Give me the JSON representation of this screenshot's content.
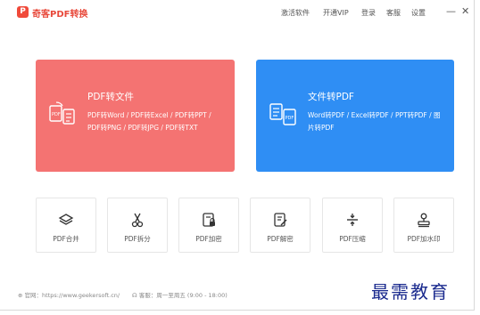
{
  "app": {
    "logo_glyph": "P",
    "title": "奇客PDF转换"
  },
  "topnav": [
    "激活软件",
    "开通VIP",
    "登录",
    "客服",
    "设置"
  ],
  "window_controls": {
    "minimize": "—",
    "close": "✕"
  },
  "cards": [
    {
      "title": "PDF转文件",
      "desc": "PDF转Word / PDF转Excel / PDF转PPT / PDF转PNG / PDF转JPG / PDF转TXT",
      "color": "#f47372",
      "icon": "pdf-to-file-icon"
    },
    {
      "title": "文件转PDF",
      "desc": "Word转PDF / Excel转PDF / PPT转PDF / 图片转PDF",
      "color": "#2f8ef4",
      "icon": "file-to-pdf-icon"
    }
  ],
  "tools": [
    {
      "label": "PDF合并",
      "icon": "layers-icon"
    },
    {
      "label": "PDF拆分",
      "icon": "scissors-icon"
    },
    {
      "label": "PDF加密",
      "icon": "lock-doc-icon"
    },
    {
      "label": "PDF解密",
      "icon": "edit-doc-icon"
    },
    {
      "label": "PDF压缩",
      "icon": "compress-icon"
    },
    {
      "label": "PDF加水印",
      "icon": "stamp-icon"
    }
  ],
  "footer": {
    "website": "官网：https://www.geekersoft.cn/",
    "support": "客服：周一至周五 (9:00 - 18:00)"
  },
  "watermark": "最需教育"
}
